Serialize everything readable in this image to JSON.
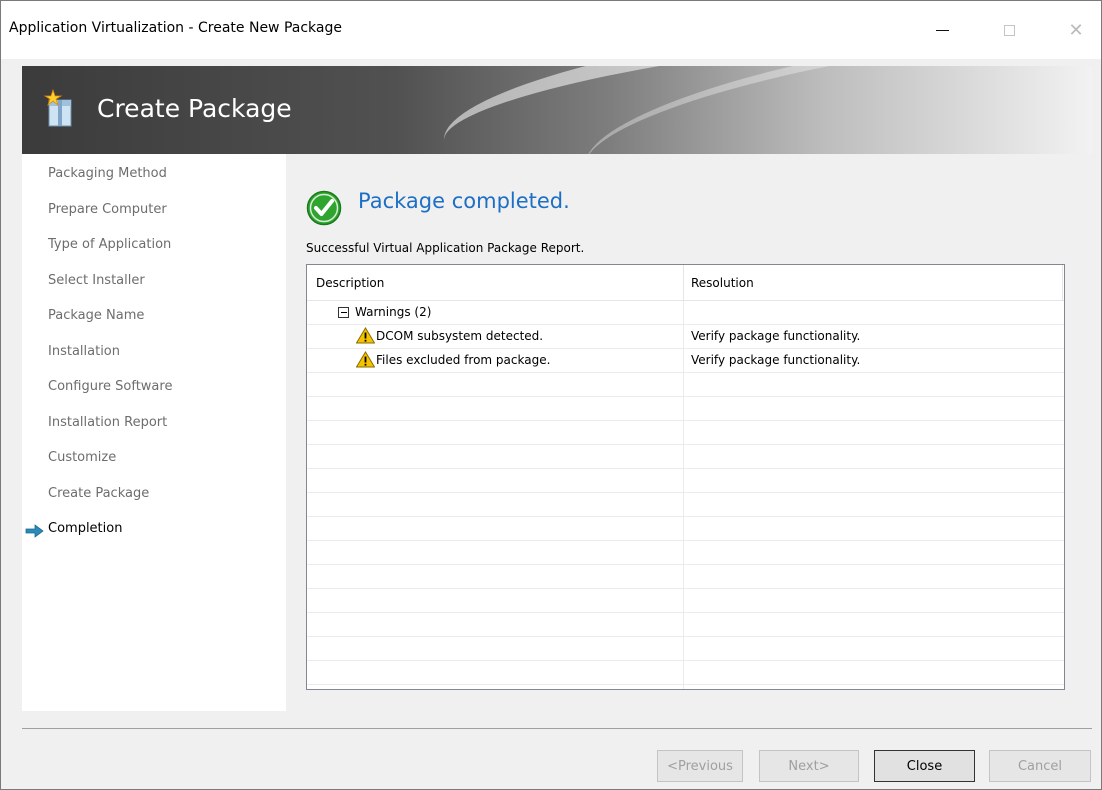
{
  "window": {
    "title": "Application Virtualization - Create New Package"
  },
  "banner": {
    "title": "Create Package"
  },
  "nav": {
    "items": [
      {
        "label": "Packaging Method"
      },
      {
        "label": "Prepare Computer"
      },
      {
        "label": "Type of Application"
      },
      {
        "label": "Select Installer"
      },
      {
        "label": "Package Name"
      },
      {
        "label": "Installation"
      },
      {
        "label": "Configure Software"
      },
      {
        "label": "Installation Report"
      },
      {
        "label": "Customize"
      },
      {
        "label": "Create Package"
      },
      {
        "label": "Completion"
      }
    ],
    "current_index": 10
  },
  "main": {
    "status": "Package completed.",
    "report_label": "Successful Virtual Application Package Report.",
    "grid": {
      "columns": [
        "Description",
        "Resolution"
      ],
      "group": "Warnings (2)",
      "rows": [
        {
          "description": "DCOM subsystem detected.",
          "resolution": "Verify package functionality.",
          "icon": "warning-icon"
        },
        {
          "description": "Files excluded from package.",
          "resolution": "Verify package functionality.",
          "icon": "warning-icon"
        }
      ]
    }
  },
  "footer": {
    "previous": "<Previous",
    "next": "Next>",
    "close": "Close",
    "cancel": "Cancel"
  },
  "colors": {
    "status_text": "#1d6fc5",
    "nav_inactive": "#6d6d6d",
    "nav_arrow": "#2a8ab8",
    "success_green": "#2fa52f",
    "warning_yellow": "#f5c400"
  }
}
